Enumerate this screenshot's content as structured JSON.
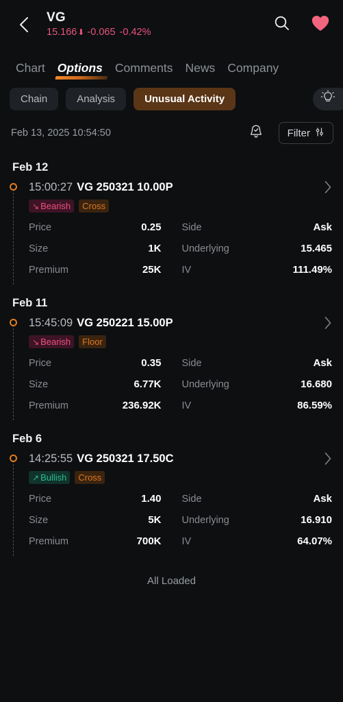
{
  "header": {
    "back_icon": "chevron-left-icon",
    "symbol": "VG",
    "last_price": "15.166",
    "arrow_glyph": "⬇",
    "change": "-0.065",
    "change_percent": "-0.42%",
    "quote_color": "#e8547c",
    "search_icon": "search-icon",
    "favorite_icon": "heart-icon",
    "favorite_color": "#f2657f"
  },
  "tabs": [
    {
      "label": "Chart",
      "active": false
    },
    {
      "label": "Options",
      "active": true
    },
    {
      "label": "Comments",
      "active": false
    },
    {
      "label": "News",
      "active": false
    },
    {
      "label": "Company",
      "active": false
    }
  ],
  "chips": [
    {
      "label": "Chain",
      "active": false
    },
    {
      "label": "Analysis",
      "active": false
    },
    {
      "label": "Unusual Activity",
      "active": true
    }
  ],
  "bulb_icon": "lightbulb-icon",
  "meta": {
    "timestamp": "Feb 13, 2025 10:54:50",
    "bell_icon": "bell-check-icon",
    "filter_label": "Filter",
    "filter_icon": "sliders-icon"
  },
  "accent_orange": "#e07d1e",
  "groups": [
    {
      "date": "Feb 12",
      "entries": [
        {
          "time": "15:00:27",
          "contract": "VG 250321 10.00P",
          "sentiment": {
            "label": "Bearish",
            "type": "bearish",
            "glyph": "↘"
          },
          "venue": {
            "label": "Cross"
          },
          "rows": [
            {
              "left_label": "Price",
              "left_value": "0.25",
              "right_label": "Side",
              "right_value": "Ask"
            },
            {
              "left_label": "Size",
              "left_value": "1K",
              "right_label": "Underlying",
              "right_value": "15.465"
            },
            {
              "left_label": "Premium",
              "left_value": "25K",
              "right_label": "IV",
              "right_value": "111.49%"
            }
          ]
        }
      ]
    },
    {
      "date": "Feb 11",
      "entries": [
        {
          "time": "15:45:09",
          "contract": "VG 250221 15.00P",
          "sentiment": {
            "label": "Bearish",
            "type": "bearish",
            "glyph": "↘"
          },
          "venue": {
            "label": "Floor"
          },
          "rows": [
            {
              "left_label": "Price",
              "left_value": "0.35",
              "right_label": "Side",
              "right_value": "Ask"
            },
            {
              "left_label": "Size",
              "left_value": "6.77K",
              "right_label": "Underlying",
              "right_value": "16.680"
            },
            {
              "left_label": "Premium",
              "left_value": "236.92K",
              "right_label": "IV",
              "right_value": "86.59%"
            }
          ]
        }
      ]
    },
    {
      "date": "Feb 6",
      "entries": [
        {
          "time": "14:25:55",
          "contract": "VG 250321 17.50C",
          "sentiment": {
            "label": "Bullish",
            "type": "bullish",
            "glyph": "↗"
          },
          "venue": {
            "label": "Cross"
          },
          "rows": [
            {
              "left_label": "Price",
              "left_value": "1.40",
              "right_label": "Side",
              "right_value": "Ask"
            },
            {
              "left_label": "Size",
              "left_value": "5K",
              "right_label": "Underlying",
              "right_value": "16.910"
            },
            {
              "left_label": "Premium",
              "left_value": "700K",
              "right_label": "IV",
              "right_value": "64.07%"
            }
          ]
        }
      ]
    }
  ],
  "footer": {
    "label": "All Loaded"
  }
}
